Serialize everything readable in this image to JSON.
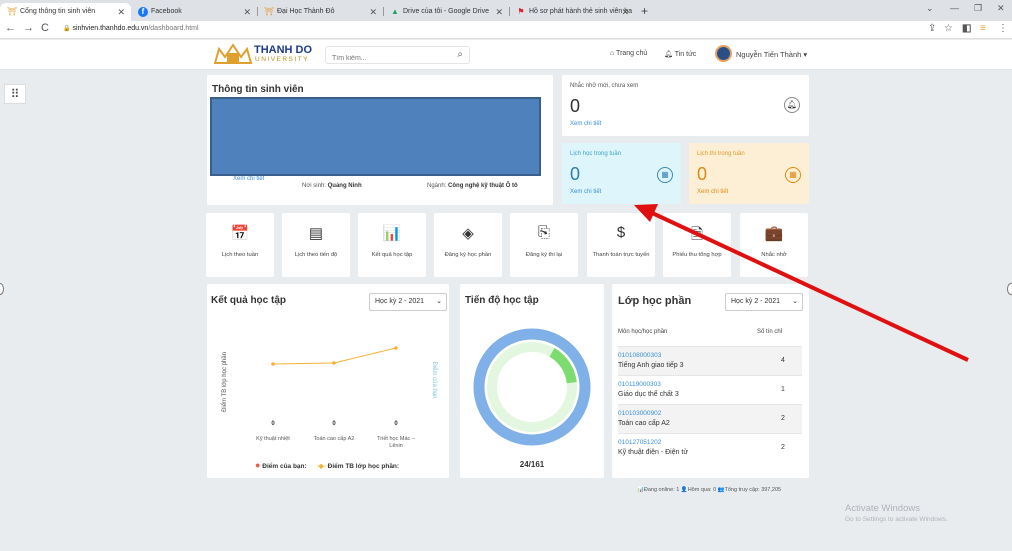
{
  "browser": {
    "tabs": [
      {
        "title": "Cổng thông tin sinh viên",
        "icon": "⛩",
        "icon_color": "#e0a030"
      },
      {
        "title": "Facebook",
        "icon": "f",
        "icon_color": "#1877f2"
      },
      {
        "title": "Đại Học Thành Đô",
        "icon": "⛩",
        "icon_color": "#e0a030"
      },
      {
        "title": "Drive của tôi - Google Drive",
        "icon": "▲",
        "icon_color": "#1fa463"
      },
      {
        "title": "Hồ sơ phát hành thẻ sinh viên ba",
        "icon": "⚑",
        "icon_color": "#d23"
      }
    ],
    "new_tab": "+",
    "url_host": "sinhvien.thanhdo.edu.vn",
    "url_path": "/dashboard.html"
  },
  "header": {
    "brand": "THANH DO",
    "brand_sub": "UNIVERSITY",
    "search_placeholder": "Tìm kiếm...",
    "nav_home": "Trang chủ",
    "nav_news": "Tin tức",
    "user_name": "Nguyễn Tiến Thành ▾"
  },
  "student": {
    "title": "Thông tin sinh viên",
    "view_detail": "Xem chi tiết",
    "birthplace_label": "Nơi sinh:",
    "birthplace": "Quảng Ninh",
    "major_label": "Ngành:",
    "major": "Công nghệ kỹ thuật Ô tô"
  },
  "stats": {
    "reminders": {
      "label": "Nhắc nhở mới, chưa xem",
      "value": "0",
      "link": "Xem chi tiết"
    },
    "schedule": {
      "label": "Lịch học trong tuần",
      "value": "0",
      "link": "Xem chi tiết"
    },
    "exams": {
      "label": "Lịch thi trong tuần",
      "value": "0",
      "link": "Xem chi tiết"
    }
  },
  "tiles": [
    {
      "label": "Lịch theo tuần",
      "icon": "📅"
    },
    {
      "label": "Lịch theo tiến độ",
      "icon": "▤"
    },
    {
      "label": "Kết quả học tập",
      "icon": "📊"
    },
    {
      "label": "Đăng ký học phần",
      "icon": "◈"
    },
    {
      "label": "Đăng ký thi lại",
      "icon": "⎘"
    },
    {
      "label": "Thanh toán trực tuyến",
      "icon": "$"
    },
    {
      "label": "Phiếu thu tổng hợp",
      "icon": "🗎"
    },
    {
      "label": "Nhắc nhở",
      "icon": "💼"
    }
  ],
  "results": {
    "title": "Kết quả học tập",
    "semester": "Học kỳ 2 - 2021",
    "legend_mine": "Điểm của bạn:",
    "legend_class": "Điểm TB lớp học phần:"
  },
  "chart_data": {
    "type": "line",
    "categories": [
      "Kỹ thuật nhiệt",
      "Toán cao cấp A2",
      "Triết học Mác – Lênin"
    ],
    "series": [
      {
        "name": "Điểm của bạn:",
        "values": [
          0,
          0,
          0
        ],
        "color": "#e8604a"
      },
      {
        "name": "Điểm TB lớp học phần:",
        "values": [
          0.62,
          0.63,
          0.78
        ],
        "color": "#f2b233"
      }
    ],
    "data_labels": [
      "0",
      "0",
      "0"
    ],
    "ylabel": "Điểm TB lớp học phần",
    "ylabel_right": "Điểm của bạn",
    "ylim": [
      0,
      1
    ],
    "grid": false,
    "legend": "bottom"
  },
  "progress": {
    "title": "Tiến độ học tập",
    "completed": 24,
    "total": 161,
    "label": "24/161",
    "ring_color": "#7fb0e8",
    "fill_color": "#7ddc6f"
  },
  "classes": {
    "title": "Lớp học phần",
    "semester": "Học kỳ 2 - 2021",
    "col_course": "Môn học/học phần",
    "col_credits": "Số tín chỉ",
    "rows": [
      {
        "code": "010108000303",
        "name": "Tiếng Anh giao tiếp 3",
        "credits": "4"
      },
      {
        "code": "010119000303",
        "name": "Giáo dục thể chất 3",
        "credits": "1"
      },
      {
        "code": "010103000902",
        "name": "Toán cao cấp A2",
        "credits": "2"
      },
      {
        "code": "010127051202",
        "name": "Kỹ thuật điện - Điện tử",
        "credits": "2"
      }
    ]
  },
  "footer": {
    "stats": "📊Đang online: 1 👤Hôm qua: 0 👥Tổng truy cập: 397,205"
  },
  "os": {
    "activate_title": "Activate Windows",
    "activate_sub": "Go to Settings to activate Windows."
  },
  "annotation": {
    "arrow_color": "#e01010"
  }
}
